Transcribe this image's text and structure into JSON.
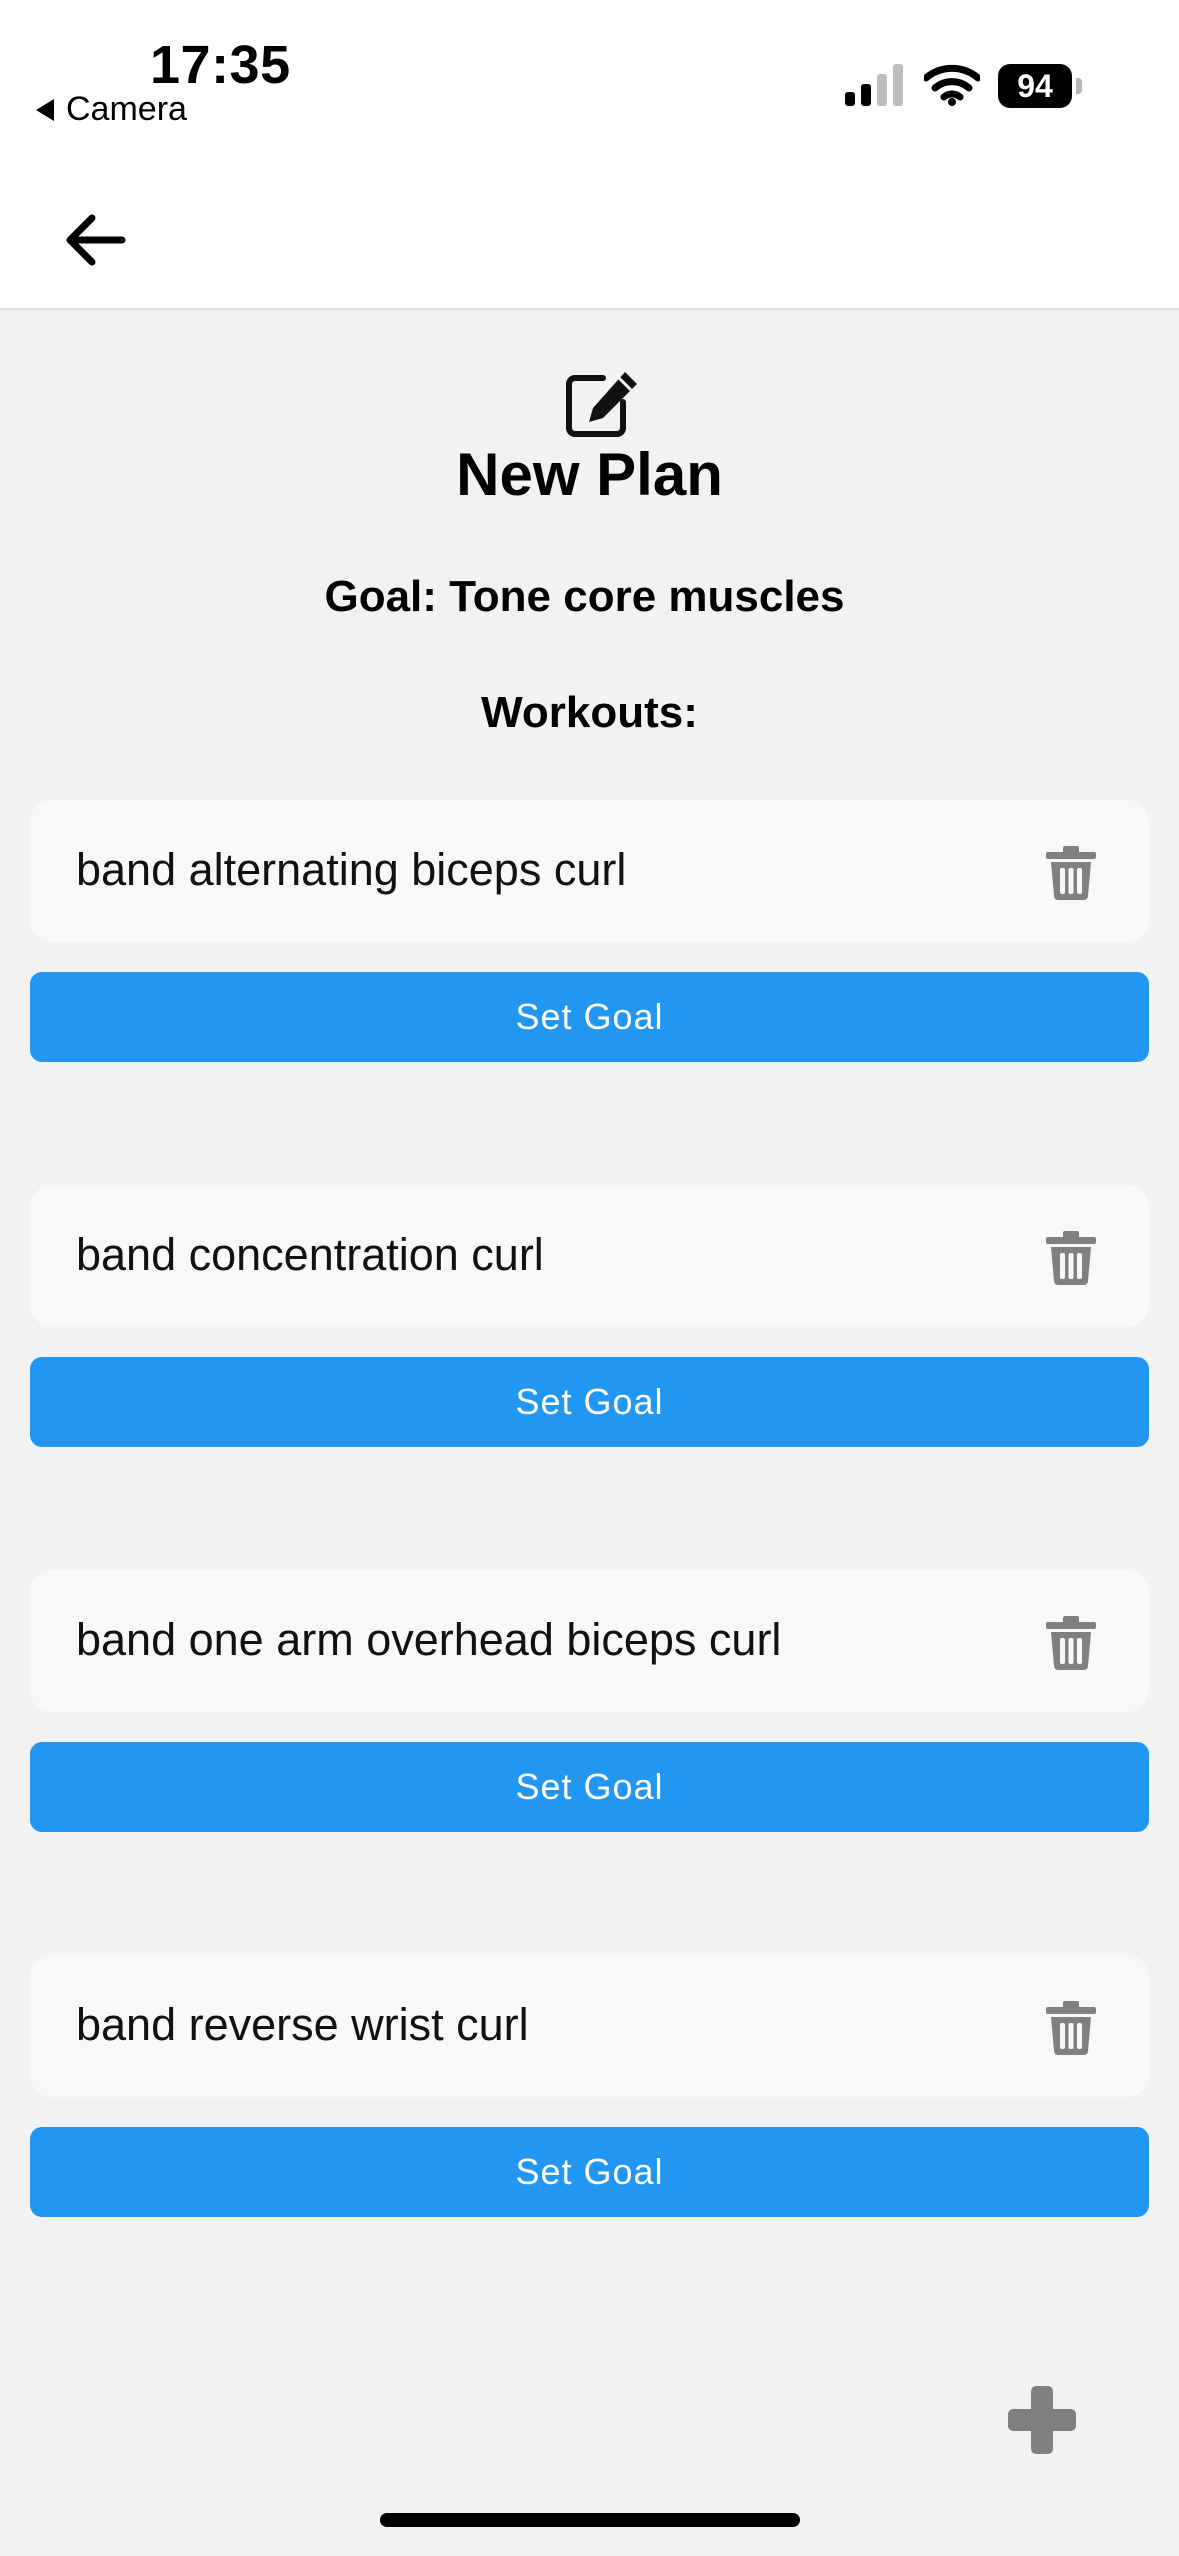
{
  "status_bar": {
    "time": "17:35",
    "back_app": "Camera",
    "battery": "94"
  },
  "nav": {
    "back_icon": "arrow-left-icon"
  },
  "header": {
    "icon": "edit-square-icon",
    "title": "New Plan",
    "goal": "Goal: Tone core muscles",
    "workouts_heading": "Workouts:"
  },
  "workouts": [
    {
      "name": "band alternating biceps curl",
      "button": "Set Goal"
    },
    {
      "name": "band concentration curl",
      "button": "Set Goal"
    },
    {
      "name": "band one arm overhead biceps curl",
      "button": "Set Goal"
    },
    {
      "name": "band reverse wrist curl",
      "button": "Set Goal"
    }
  ],
  "colors": {
    "accent": "#2196f3",
    "background": "#f2f2f2",
    "card": "#f8f8f8",
    "icon_gray": "#808080"
  },
  "icons": {
    "delete": "trash-icon",
    "add": "plus-icon"
  }
}
